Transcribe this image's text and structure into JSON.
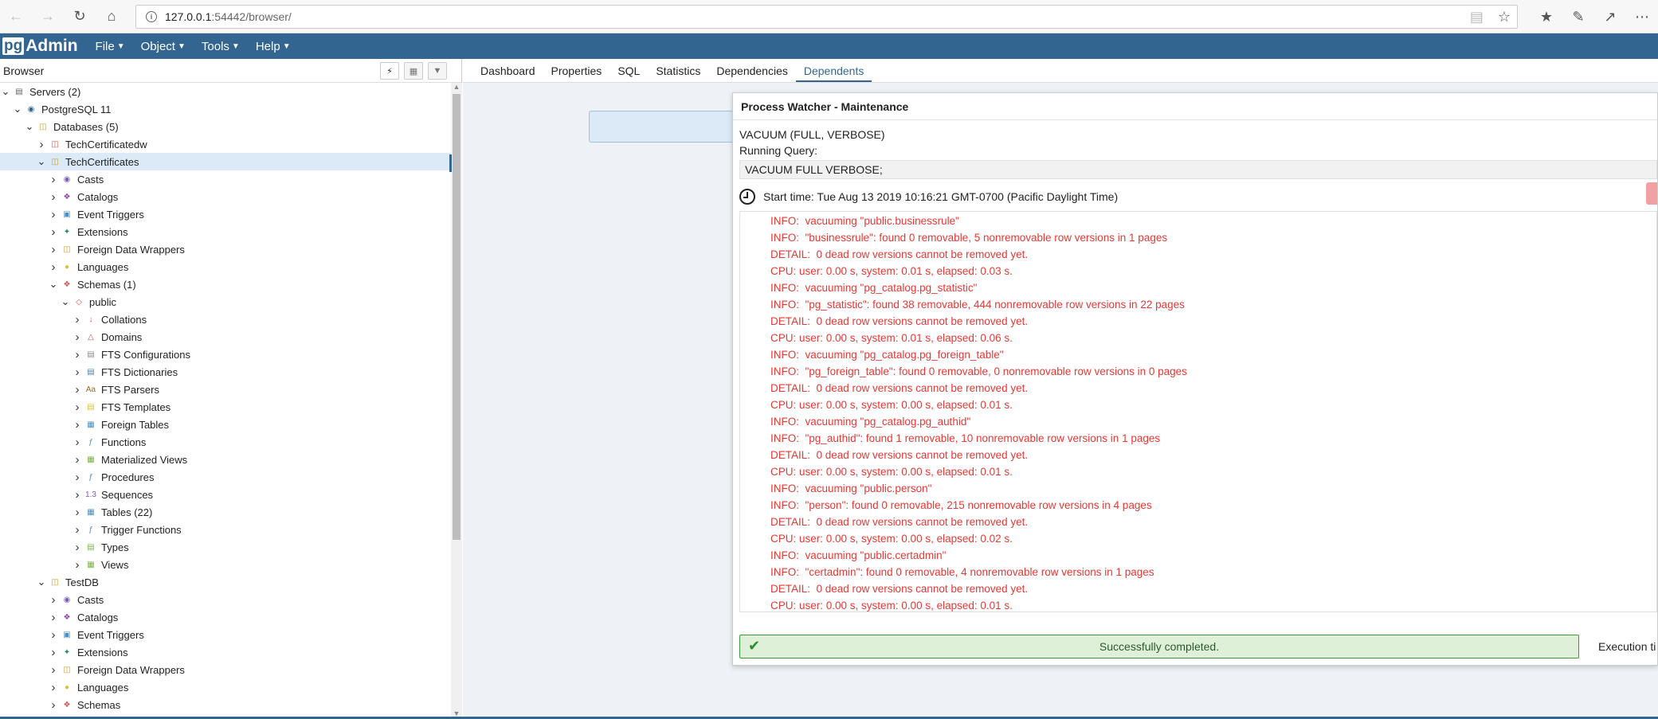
{
  "browser": {
    "url_host": "127.0.0.1",
    "url_path": ":54442/browser/"
  },
  "app": {
    "logo_pg": "pg",
    "logo_text": "Admin",
    "menus": [
      "File",
      "Object",
      "Tools",
      "Help"
    ]
  },
  "panel": {
    "title": "Browser"
  },
  "tree": [
    {
      "level": 0,
      "tw": "v",
      "icon": "servers-icon",
      "color": "#666",
      "label": "Servers (2)"
    },
    {
      "level": 1,
      "tw": "v",
      "icon": "postgres-elephant-icon",
      "color": "#336791",
      "label": "PostgreSQL 11"
    },
    {
      "level": 2,
      "tw": "v",
      "icon": "databases-icon",
      "color": "#c9a227",
      "label": "Databases (5)"
    },
    {
      "level": 3,
      "tw": ">",
      "icon": "database-icon",
      "color": "#d9534f",
      "label": "TechCertificatedw"
    },
    {
      "level": 3,
      "tw": "v",
      "icon": "database-icon",
      "color": "#c9a227",
      "label": "TechCertificates",
      "selected": true
    },
    {
      "level": 4,
      "tw": ">",
      "icon": "casts-icon",
      "color": "#7a5fb5",
      "label": "Casts"
    },
    {
      "level": 4,
      "tw": ">",
      "icon": "catalogs-icon",
      "color": "#8e44ad",
      "label": "Catalogs"
    },
    {
      "level": 4,
      "tw": ">",
      "icon": "event-triggers-icon",
      "color": "#4a90c2",
      "label": "Event Triggers"
    },
    {
      "level": 4,
      "tw": ">",
      "icon": "extensions-icon",
      "color": "#2e8b57",
      "label": "Extensions"
    },
    {
      "level": 4,
      "tw": ">",
      "icon": "foreign-data-wrappers-icon",
      "color": "#c9a227",
      "label": "Foreign Data Wrappers"
    },
    {
      "level": 4,
      "tw": ">",
      "icon": "languages-icon",
      "color": "#e0c030",
      "label": "Languages"
    },
    {
      "level": 4,
      "tw": "v",
      "icon": "schemas-icon",
      "color": "#d9534f",
      "label": "Schemas (1)"
    },
    {
      "level": 5,
      "tw": "v",
      "icon": "schema-icon",
      "color": "#d9534f",
      "label": "public"
    },
    {
      "level": 6,
      "tw": ">",
      "icon": "collations-icon",
      "color": "#d9534f",
      "label": "Collations"
    },
    {
      "level": 6,
      "tw": ">",
      "icon": "domains-icon",
      "color": "#b05050",
      "label": "Domains"
    },
    {
      "level": 6,
      "tw": ">",
      "icon": "fts-configurations-icon",
      "color": "#888",
      "label": "FTS Configurations"
    },
    {
      "level": 6,
      "tw": ">",
      "icon": "fts-dictionaries-icon",
      "color": "#4a7fb0",
      "label": "FTS Dictionaries"
    },
    {
      "level": 6,
      "tw": ">",
      "icon": "fts-parsers-icon",
      "color": "#8a6d1f",
      "label": "FTS Parsers"
    },
    {
      "level": 6,
      "tw": ">",
      "icon": "fts-templates-icon",
      "color": "#e0c030",
      "label": "FTS Templates"
    },
    {
      "level": 6,
      "tw": ">",
      "icon": "foreign-tables-icon",
      "color": "#4a90c2",
      "label": "Foreign Tables"
    },
    {
      "level": 6,
      "tw": ">",
      "icon": "functions-icon",
      "color": "#4a90c2",
      "label": "Functions"
    },
    {
      "level": 6,
      "tw": ">",
      "icon": "materialized-views-icon",
      "color": "#7cb342",
      "label": "Materialized Views"
    },
    {
      "level": 6,
      "tw": ">",
      "icon": "procedures-icon",
      "color": "#4a90c2",
      "label": "Procedures"
    },
    {
      "level": 6,
      "tw": ">",
      "icon": "sequences-icon",
      "color": "#7a5fb5",
      "label": "Sequences"
    },
    {
      "level": 6,
      "tw": ">",
      "icon": "tables-icon",
      "color": "#4a90c2",
      "label": "Tables (22)"
    },
    {
      "level": 6,
      "tw": ">",
      "icon": "trigger-functions-icon",
      "color": "#4a90c2",
      "label": "Trigger Functions"
    },
    {
      "level": 6,
      "tw": ">",
      "icon": "types-icon",
      "color": "#7cb342",
      "label": "Types"
    },
    {
      "level": 6,
      "tw": ">",
      "icon": "views-icon",
      "color": "#7cb342",
      "label": "Views"
    },
    {
      "level": 3,
      "tw": "v",
      "icon": "database-icon",
      "color": "#c9a227",
      "label": "TestDB"
    },
    {
      "level": 4,
      "tw": ">",
      "icon": "casts-icon",
      "color": "#7a5fb5",
      "label": "Casts"
    },
    {
      "level": 4,
      "tw": ">",
      "icon": "catalogs-icon",
      "color": "#8e44ad",
      "label": "Catalogs"
    },
    {
      "level": 4,
      "tw": ">",
      "icon": "event-triggers-icon",
      "color": "#4a90c2",
      "label": "Event Triggers"
    },
    {
      "level": 4,
      "tw": ">",
      "icon": "extensions-icon",
      "color": "#2e8b57",
      "label": "Extensions"
    },
    {
      "level": 4,
      "tw": ">",
      "icon": "foreign-data-wrappers-icon",
      "color": "#c9a227",
      "label": "Foreign Data Wrappers"
    },
    {
      "level": 4,
      "tw": ">",
      "icon": "languages-icon",
      "color": "#e0c030",
      "label": "Languages"
    },
    {
      "level": 4,
      "tw": ">",
      "icon": "schemas-icon",
      "color": "#d9534f",
      "label": "Schemas"
    }
  ],
  "tabs": [
    {
      "label": "Dashboard",
      "active": false
    },
    {
      "label": "Properties",
      "active": false
    },
    {
      "label": "SQL",
      "active": false
    },
    {
      "label": "Statistics",
      "active": false
    },
    {
      "label": "Dependencies",
      "active": false
    },
    {
      "label": "Dependents",
      "active": true
    }
  ],
  "process_watcher": {
    "title": "Process Watcher - Maintenance",
    "command": "VACUUM (FULL, VERBOSE)",
    "running_query_label": "Running Query:",
    "query": "VACUUM FULL VERBOSE;",
    "start_time": "Start time: Tue Aug 13 2019 10:16:21 GMT-0700 (Pacific Daylight Time)",
    "log": [
      "INFO:  vacuuming \"public.businessrule\"",
      "INFO:  \"businessrule\": found 0 removable, 5 nonremovable row versions in 1 pages",
      "DETAIL:  0 dead row versions cannot be removed yet.",
      "CPU: user: 0.00 s, system: 0.01 s, elapsed: 0.03 s.",
      "INFO:  vacuuming \"pg_catalog.pg_statistic\"",
      "INFO:  \"pg_statistic\": found 38 removable, 444 nonremovable row versions in 22 pages",
      "DETAIL:  0 dead row versions cannot be removed yet.",
      "CPU: user: 0.00 s, system: 0.01 s, elapsed: 0.06 s.",
      "INFO:  vacuuming \"pg_catalog.pg_foreign_table\"",
      "INFO:  \"pg_foreign_table\": found 0 removable, 0 nonremovable row versions in 0 pages",
      "DETAIL:  0 dead row versions cannot be removed yet.",
      "CPU: user: 0.00 s, system: 0.00 s, elapsed: 0.01 s.",
      "INFO:  vacuuming \"pg_catalog.pg_authid\"",
      "INFO:  \"pg_authid\": found 1 removable, 10 nonremovable row versions in 1 pages",
      "DETAIL:  0 dead row versions cannot be removed yet.",
      "CPU: user: 0.00 s, system: 0.00 s, elapsed: 0.01 s.",
      "INFO:  vacuuming \"public.person\"",
      "INFO:  \"person\": found 0 removable, 215 nonremovable row versions in 4 pages",
      "DETAIL:  0 dead row versions cannot be removed yet.",
      "CPU: user: 0.00 s, system: 0.00 s, elapsed: 0.02 s.",
      "INFO:  vacuuming \"public.certadmin\"",
      "INFO:  \"certadmin\": found 0 removable, 4 nonremovable row versions in 1 pages",
      "DETAIL:  0 dead row versions cannot be removed yet.",
      "CPU: user: 0.00 s, system: 0.00 s, elapsed: 0.01 s."
    ],
    "status": "Successfully completed.",
    "execution_label": "Execution ti"
  }
}
